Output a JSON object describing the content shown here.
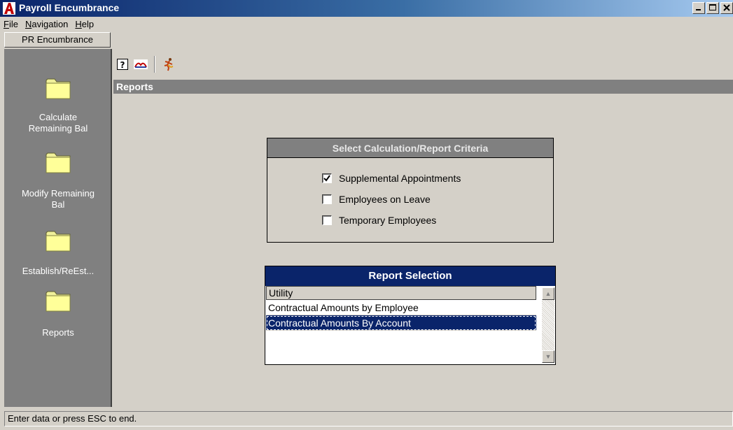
{
  "window": {
    "title": "Payroll Encumbrance",
    "logo_letter": "A",
    "controls": [
      "minimize-icon",
      "maximize-icon",
      "close-icon"
    ]
  },
  "menu": {
    "items": [
      {
        "label": "File",
        "underline": "F"
      },
      {
        "label": "Navigation",
        "underline": "N"
      },
      {
        "label": "Help",
        "underline": "H"
      }
    ]
  },
  "sidebar": {
    "tab_label": "PR Encumbrance",
    "items": [
      {
        "label": "Calculate Remaining Bal",
        "icon": "folder-icon"
      },
      {
        "label": "Modify Remaining Bal",
        "icon": "folder-icon"
      },
      {
        "label": "Establish/ReEst...",
        "icon": "folder-icon"
      },
      {
        "label": "Reports",
        "icon": "folder-icon"
      }
    ]
  },
  "toolbar": {
    "buttons": [
      "help-icon",
      "gables-logo-icon",
      "exit-runner-icon"
    ]
  },
  "content": {
    "section_title": "Reports",
    "criteria": {
      "title": "Select Calculation/Report Criteria",
      "options": [
        {
          "label": "Supplemental Appointments",
          "checked": true
        },
        {
          "label": "Employees on Leave",
          "checked": false
        },
        {
          "label": "Temporary Employees",
          "checked": false
        }
      ]
    },
    "report_selection": {
      "title": "Report Selection",
      "column_header": "Utility",
      "rows": [
        {
          "label": "Contractual Amounts by Employee",
          "selected": false
        },
        {
          "label": "Contractual Amounts By Account",
          "selected": true
        }
      ]
    }
  },
  "status": {
    "text": "Enter data or press ESC to end."
  },
  "colors": {
    "title_gradient_start": "#0a246a",
    "selection": "#0a246a",
    "sidebar_bg": "#808080",
    "window_bg": "#d4d0c8"
  }
}
